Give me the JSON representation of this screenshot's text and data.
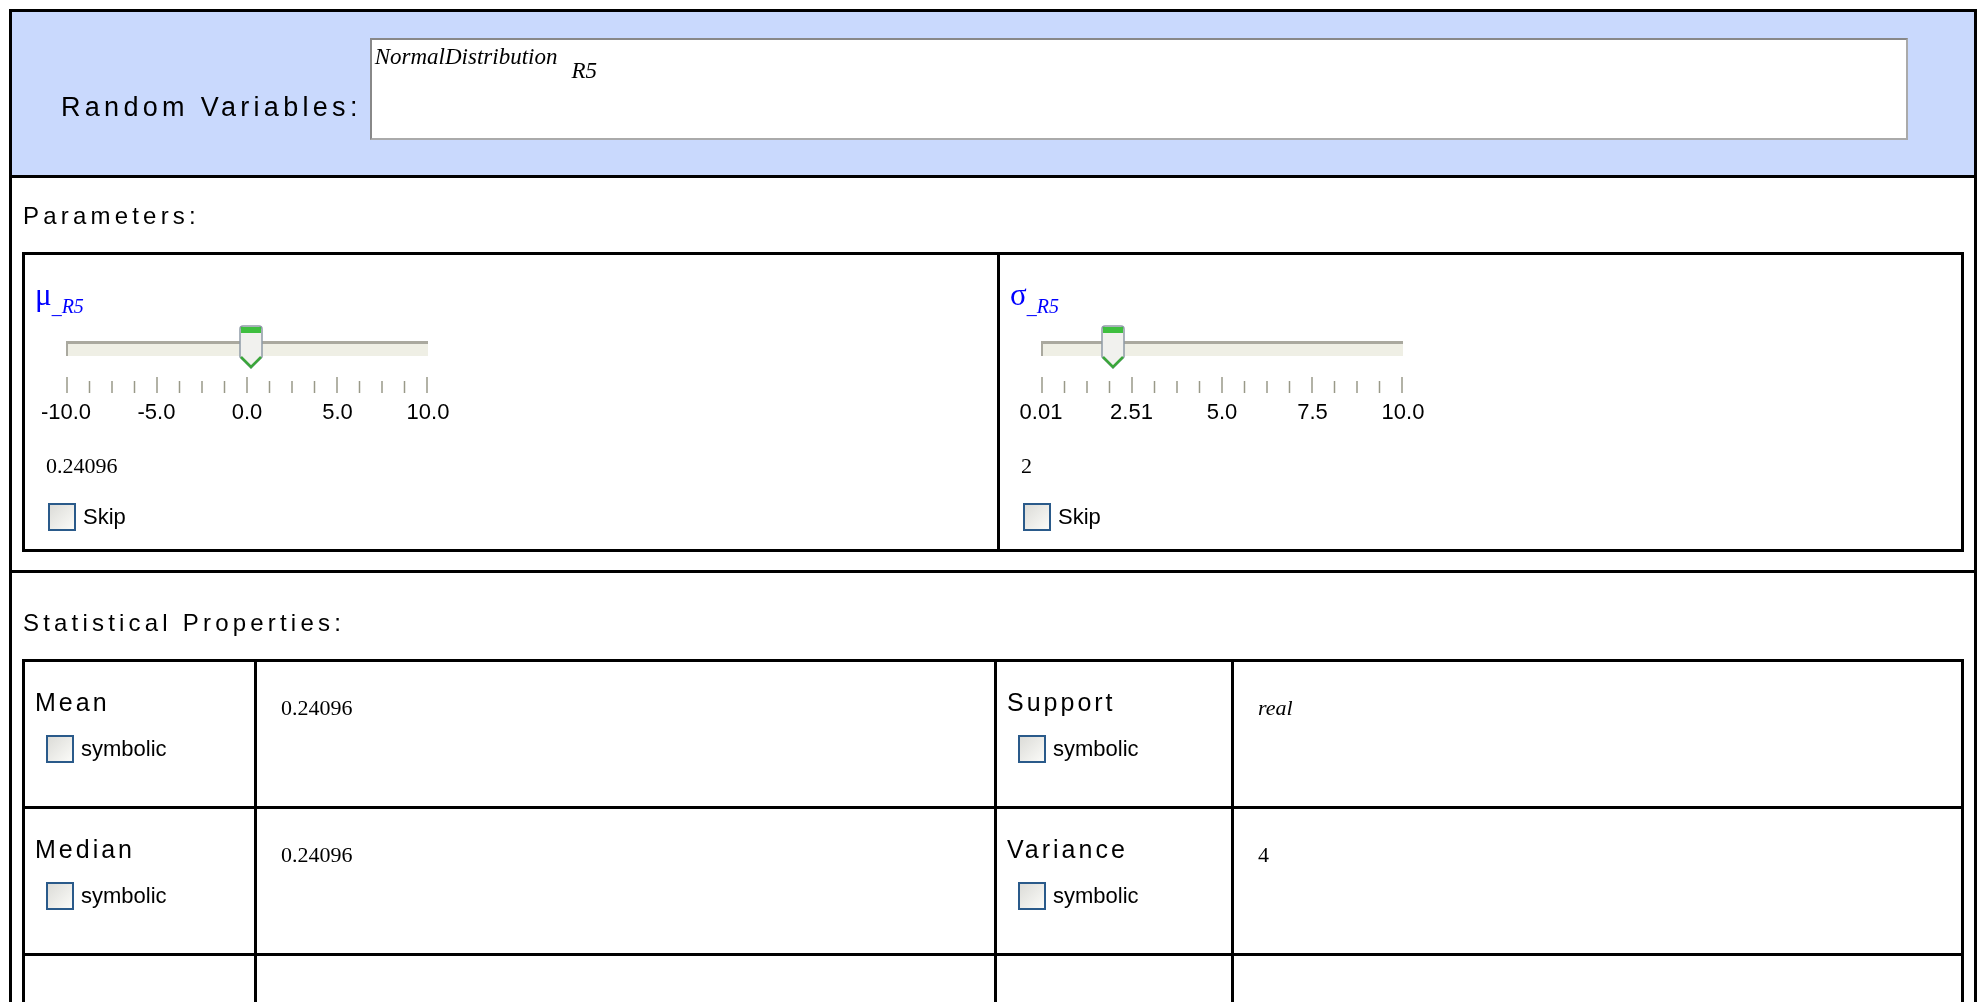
{
  "random_variables": {
    "label": "Random Variables:",
    "expression": {
      "name": "NormalDistribution",
      "argument": "R5"
    }
  },
  "parameters": {
    "title": "Parameters:",
    "items": [
      {
        "symbol": "μ",
        "subscript": "_R5",
        "level": 0.512,
        "tick_labels": [
          "-10.0",
          "-5.0",
          "0.0",
          "5.0",
          "10.0"
        ],
        "value": "0.24096",
        "skip": {
          "label": "Skip",
          "checked": false
        }
      },
      {
        "symbol": "σ",
        "subscript": "_R5",
        "level": 0.199,
        "tick_labels": [
          "0.01",
          "2.51",
          "5.0",
          "7.5",
          "10.0"
        ],
        "value": "2",
        "skip": {
          "label": "Skip",
          "checked": false
        }
      }
    ]
  },
  "statistical_properties": {
    "title": "Statistical Properties:",
    "rows": [
      [
        {
          "label": "Mean",
          "symbolic": {
            "label": "symbolic",
            "checked": false
          },
          "value": "0.24096",
          "italic": false
        },
        {
          "label": "Support",
          "symbolic": {
            "label": "symbolic",
            "checked": false
          },
          "value": "real",
          "italic": true
        }
      ],
      [
        {
          "label": "Median",
          "symbolic": {
            "label": "symbolic",
            "checked": false
          },
          "value": "0.24096",
          "italic": false
        },
        {
          "label": "Variance",
          "symbolic": {
            "label": "symbolic",
            "checked": false
          },
          "value": "4",
          "italic": false
        }
      ]
    ]
  }
}
